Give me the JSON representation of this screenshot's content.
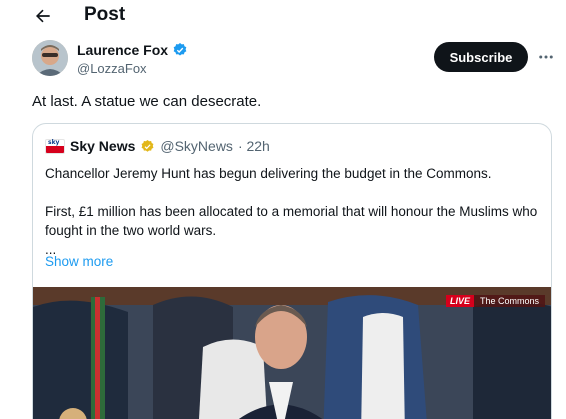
{
  "header": {
    "title": "Post",
    "back_icon": "arrow-left-icon"
  },
  "author": {
    "name": "Laurence Fox",
    "handle": "@LozzaFox",
    "verified": true,
    "verified_color": "#1d9bf0",
    "subscribe_label": "Subscribe",
    "more_icon": "more-horizontal-icon"
  },
  "tweet": {
    "text": "At last. A statue we can desecrate."
  },
  "quote": {
    "source_name": "Sky News",
    "source_handle": "@SkyNews",
    "time": "· 22h",
    "verified_color": "#e2b719",
    "line1": "Chancellor Jeremy Hunt has begun delivering the budget in the Commons.",
    "line2": "First, £1 million has been allocated to a memorial that will honour the Muslims who fought in the two world wars.",
    "ellipsis": "...",
    "show_more": "Show more",
    "media": {
      "live_label": "LIVE",
      "location_label": "The Commons"
    }
  },
  "colors": {
    "accent": "#1d9bf0",
    "text": "#0f1419",
    "muted": "#536471",
    "border": "#cfd9de",
    "live_red": "#d6001c"
  }
}
